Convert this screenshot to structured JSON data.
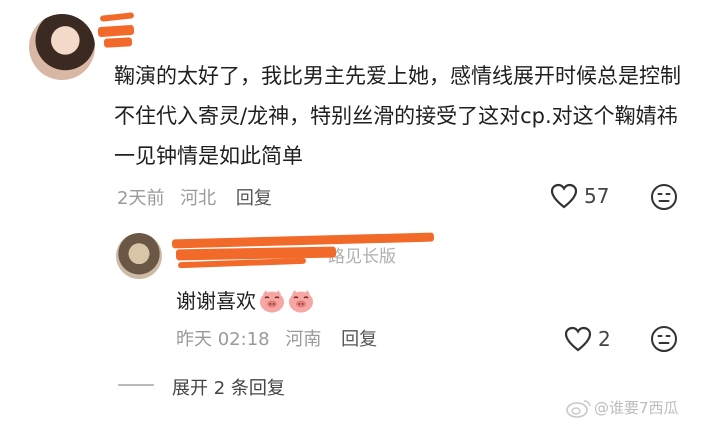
{
  "comment": {
    "text": "鞠演的太好了，我比男主先爱上她，感情线展开时候总是控制不住代入寄灵/龙神，特别丝滑的接受了这对cp.对这个鞠婧祎一见钟情是如此简单",
    "time": "2天前",
    "location": "河北",
    "reply_label": "回复",
    "like_count": "57"
  },
  "reply": {
    "username_fragment": "路见长版",
    "text": "谢谢喜欢",
    "time": "昨天 02:18",
    "location": "河南",
    "reply_label": "回复",
    "like_count": "2"
  },
  "expand_replies": "展开 2 条回复",
  "watermark": "@谁要7西瓜",
  "icons": {
    "like": "heart-outline-icon",
    "dislike": "frown-face-icon",
    "emoji": "pig-face-emoji",
    "watermark": "weibo-icon"
  },
  "colors": {
    "redaction": "#f26a2a",
    "meta_text": "#9a9a9a"
  }
}
